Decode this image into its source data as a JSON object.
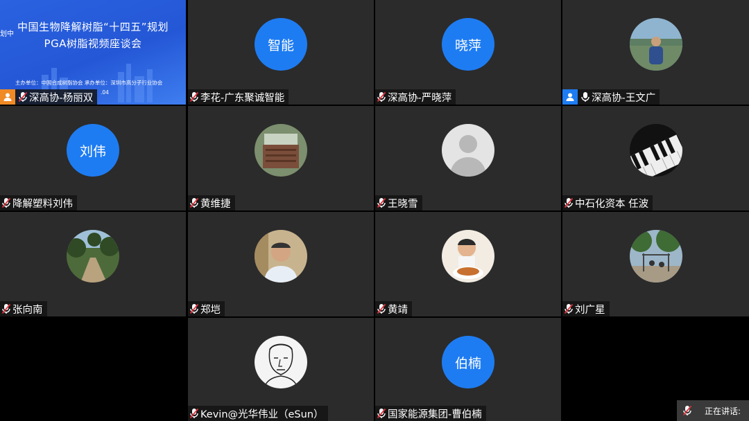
{
  "presentation": {
    "title_line1": "中国生物降解树脂“十四五”规划",
    "title_line2": "PGA树脂视频座谈会",
    "side_text": "划中",
    "footer_text": "主办单位：中国合成树脂协会  承办单位：深圳市高分子行业协会",
    "date_fragment": ".04"
  },
  "participants": [
    {
      "name": "深高协-杨丽双",
      "avatar_type": "presentation",
      "mic": "muted",
      "badge": "orange"
    },
    {
      "name": "李花-广东聚诚智能",
      "avatar_type": "text",
      "avatar_text": "智能",
      "mic": "muted"
    },
    {
      "name": "深高协-严晓萍",
      "avatar_type": "text",
      "avatar_text": "晓萍",
      "mic": "muted"
    },
    {
      "name": "深高协-王文广",
      "avatar_type": "photo",
      "photo": "landscape-person",
      "mic": "on",
      "badge": "blue"
    },
    {
      "name": "降解塑料刘伟",
      "avatar_type": "text",
      "avatar_text": "刘伟",
      "mic": "muted"
    },
    {
      "name": "黄维捷",
      "avatar_type": "photo",
      "photo": "crate-photo",
      "mic": "muted"
    },
    {
      "name": "王晓雪",
      "avatar_type": "photo",
      "photo": "default-person",
      "mic": "muted"
    },
    {
      "name": "中石化资本 任波",
      "avatar_type": "photo",
      "photo": "piano-keys",
      "mic": "muted"
    },
    {
      "name": "张向南",
      "avatar_type": "photo",
      "photo": "trees-path",
      "mic": "muted"
    },
    {
      "name": "郑垲",
      "avatar_type": "photo",
      "photo": "man-portrait",
      "mic": "muted"
    },
    {
      "name": "黄靖",
      "avatar_type": "photo",
      "photo": "child-cake",
      "mic": "muted"
    },
    {
      "name": "刘广星",
      "avatar_type": "photo",
      "photo": "park-exercise",
      "mic": "muted"
    },
    {
      "name": "Kevin@光华伟业（eSun）",
      "avatar_type": "photo",
      "photo": "sketch-face",
      "mic": "muted"
    },
    {
      "name": "国家能源集团-曹伯楠",
      "avatar_type": "text",
      "avatar_text": "伯楠",
      "mic": "muted"
    }
  ],
  "speaking_indicator": {
    "label": "正在讲话:"
  },
  "colors": {
    "avatar_blue": "#1e7cf2",
    "tile_bg": "#2b2b2b",
    "muted_red": "#e0303a"
  }
}
